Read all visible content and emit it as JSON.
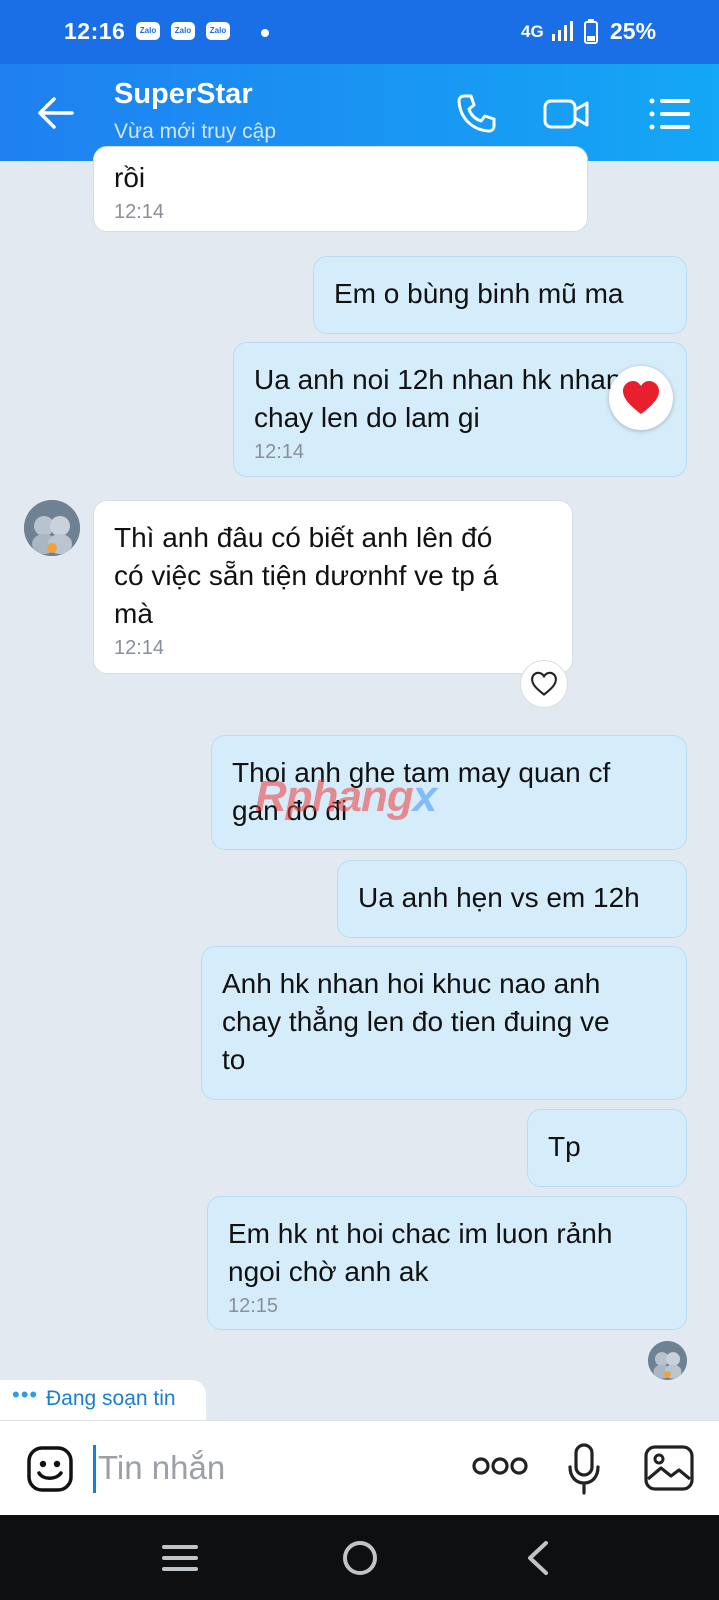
{
  "status": {
    "time": "12:16",
    "badge": "Zalo",
    "network": "4G",
    "battery": "25%"
  },
  "header": {
    "title": "SuperStar",
    "subtitle": "Vừa mới truy cập"
  },
  "messages": {
    "m0": {
      "text": "rồi",
      "time": "12:14"
    },
    "m1": {
      "text": "Em o bùng binh mũ ma"
    },
    "m2": {
      "text": "Ua anh noi 12h nhan hk nhan\nchay len do lam gi",
      "time": "12:14"
    },
    "m3": {
      "text": "Thì anh đâu có biết anh lên đó\ncó việc sẵn tiện dươnhf ve tp á\nmà",
      "time": "12:14"
    },
    "m4": {
      "text": "Thoi anh ghe tam may quan cf\ngan đo đi"
    },
    "m5": {
      "text": "Ua anh hẹn vs em 12h"
    },
    "m6": {
      "text": "Anh hk nhan hoi khuc nao anh\nchay thẳng len đo tien đuing ve\nto"
    },
    "m7": {
      "text": "Tp"
    },
    "m8": {
      "text": "Em hk nt hoi chac im luon rảnh\nngoi chờ anh ak",
      "time": "12:15"
    }
  },
  "watermark": {
    "part1": "Rphang",
    "part2": "x"
  },
  "typing": {
    "dots": "•••",
    "label": "Đang soạn tin"
  },
  "composer": {
    "placeholder": "Tin nhắn"
  },
  "colors": {
    "accent": "#1a6fe6",
    "outgoing": "#d5ecfb",
    "incoming": "#ffffff",
    "heart": "#e8202e"
  },
  "icons": [
    "back-arrow-icon",
    "phone-icon",
    "video-call-icon",
    "menu-list-icon",
    "heart-icon",
    "sticker-icon",
    "more-icon",
    "microphone-icon",
    "image-icon"
  ]
}
